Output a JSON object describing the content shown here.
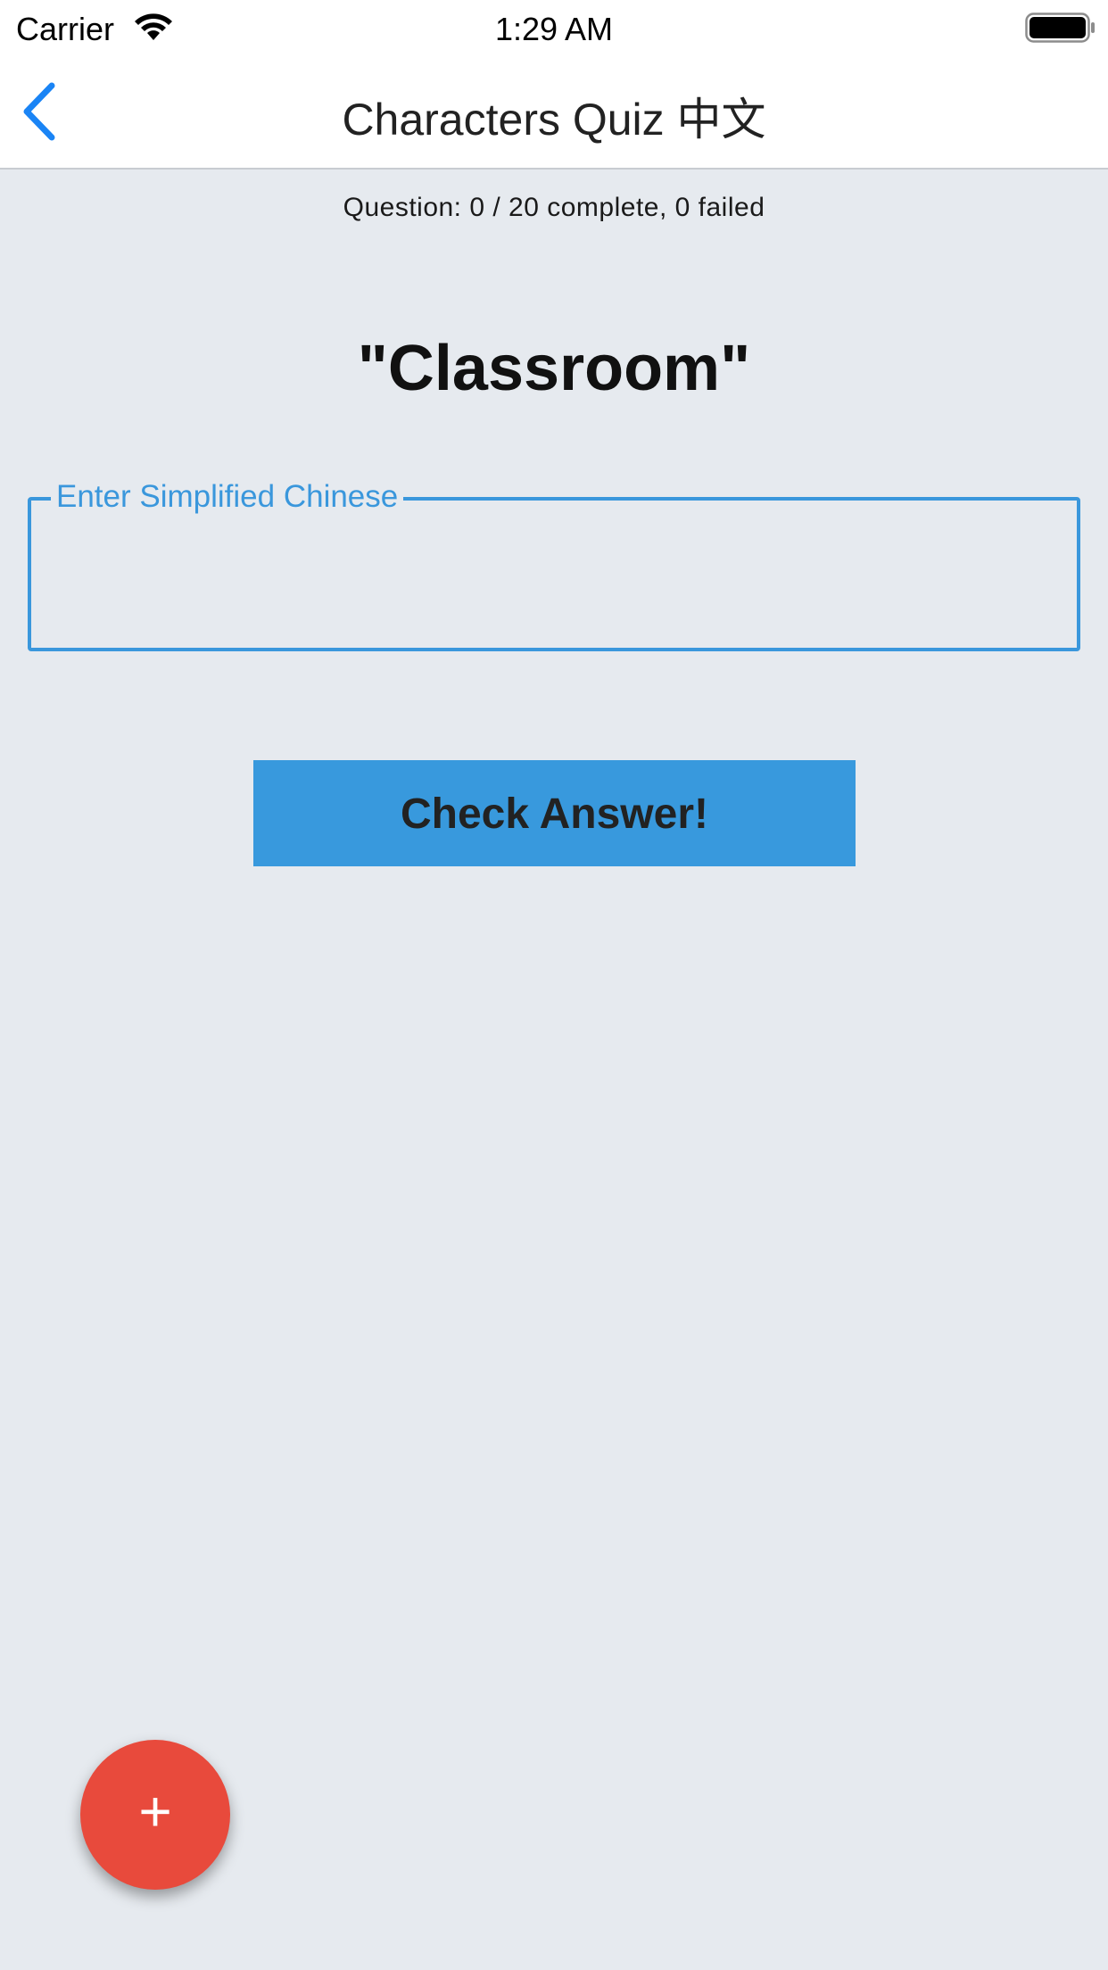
{
  "status_bar": {
    "carrier": "Carrier",
    "time": "1:29 AM",
    "wifi_icon": "wifi-icon",
    "battery_icon": "battery-full-icon"
  },
  "nav": {
    "back_icon": "chevron-left-icon",
    "title": "Characters Quiz 中文",
    "accent_color": "#1a84f5"
  },
  "quiz": {
    "progress": "Question: 0 / 20 complete, 0 failed",
    "prompt": "\"Classroom\"",
    "answer_label": "Enter Simplified Chinese",
    "answer_value": "",
    "check_button_label": "Check Answer!",
    "accent_color": "#3899dd"
  },
  "fab": {
    "icon": "plus-icon",
    "glyph": "+",
    "color": "#e84a3c"
  }
}
